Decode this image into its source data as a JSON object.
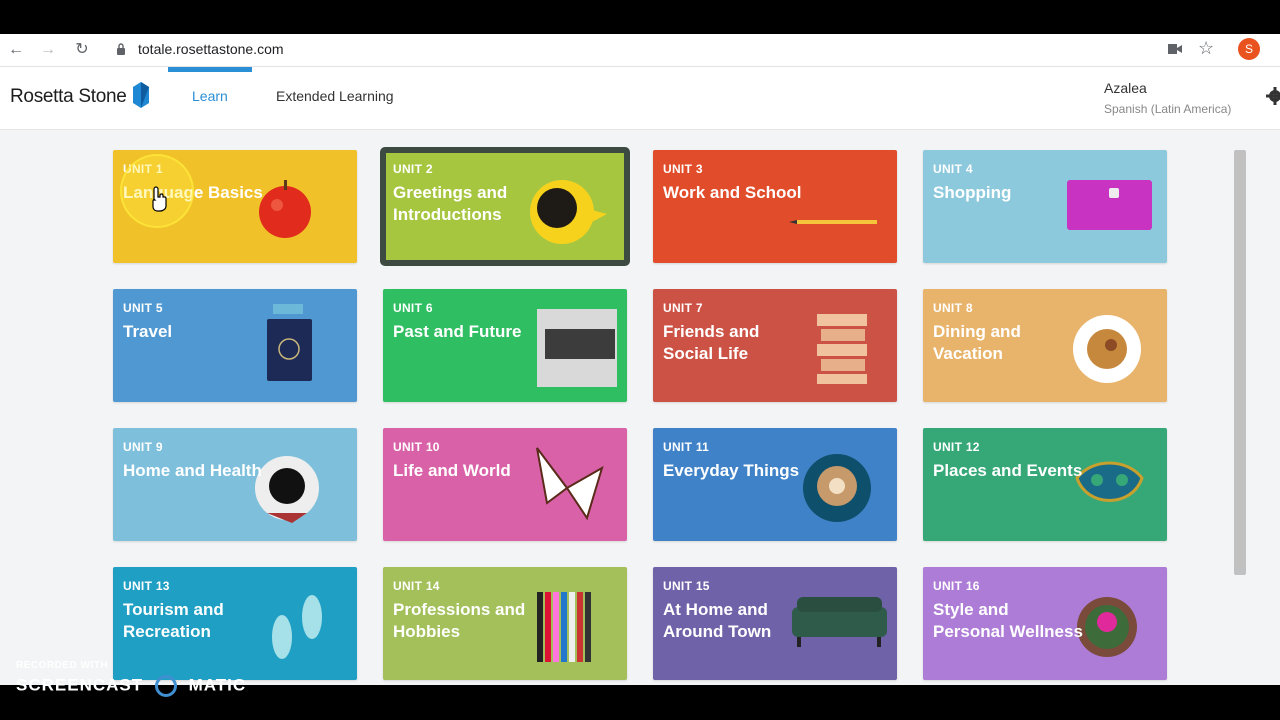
{
  "browser": {
    "url": "totale.rosettastone.com",
    "profile_initial": "S"
  },
  "app": {
    "logo_text": "Rosetta Stone",
    "tabs": [
      {
        "label": "Learn",
        "active": true
      },
      {
        "label": "Extended Learning",
        "active": false
      }
    ],
    "user": {
      "name": "Azalea",
      "language": "Spanish (Latin America)"
    }
  },
  "units": [
    {
      "unit": "UNIT 1",
      "title": "Language Basics",
      "color": "#f1c12a",
      "art": "apple"
    },
    {
      "unit": "UNIT 2",
      "title": "Greetings and Introductions",
      "color": "#a7c640",
      "art": "coffee-cup"
    },
    {
      "unit": "UNIT 3",
      "title": "Work and School",
      "color": "#e14c2a",
      "art": "pencil"
    },
    {
      "unit": "UNIT 4",
      "title": "Shopping",
      "color": "#8dc9dc",
      "art": "wallet"
    },
    {
      "unit": "UNIT 5",
      "title": "Travel",
      "color": "#4f98d2",
      "art": "passport"
    },
    {
      "unit": "UNIT 6",
      "title": "Past and Future",
      "color": "#2fbe62",
      "art": "laptop"
    },
    {
      "unit": "UNIT 7",
      "title": "Friends and Social Life",
      "color": "#cc5245",
      "art": "blocks"
    },
    {
      "unit": "UNIT 8",
      "title": "Dining and Vacation",
      "color": "#e8b46c",
      "art": "pasta-plate"
    },
    {
      "unit": "UNIT 9",
      "title": "Home and Health",
      "color": "#7ec0dc",
      "art": "tea-cup"
    },
    {
      "unit": "UNIT 10",
      "title": "Life and World",
      "color": "#d961a8",
      "art": "butterfly"
    },
    {
      "unit": "UNIT 11",
      "title": "Everyday Things",
      "color": "#3f82c8",
      "art": "latte"
    },
    {
      "unit": "UNIT 12",
      "title": "Places and Events",
      "color": "#36a878",
      "art": "mask"
    },
    {
      "unit": "UNIT 13",
      "title": "Tourism and Recreation",
      "color": "#1f9fc3",
      "art": "flip-flops"
    },
    {
      "unit": "UNIT 14",
      "title": "Professions and Hobbies",
      "color": "#a3c05a",
      "art": "books"
    },
    {
      "unit": "UNIT 15",
      "title": "At Home and Around Town",
      "color": "#6f62a8",
      "art": "sofa"
    },
    {
      "unit": "UNIT 16",
      "title": "Style and Personal Wellness",
      "color": "#ad7cd6",
      "art": "flower-pot"
    }
  ],
  "selected_unit": "UNIT 2",
  "watermark": {
    "line1": "RECORDED WITH",
    "line2": "SCREENCAST",
    "line3": "MATIC"
  }
}
